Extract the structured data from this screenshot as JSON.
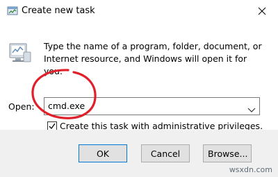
{
  "window": {
    "title": "Create new task",
    "icon": "task-manager-icon",
    "close_icon": "close-icon"
  },
  "dialog": {
    "icon": "run-dialog-icon",
    "description": "Type the name of a program, folder, document, or Internet resource, and Windows will open it for you.",
    "open_label": "Open:",
    "open_value": "cmd.exe",
    "admin_checkbox": {
      "label": "Create this task with administrative privileges.",
      "checked": true
    }
  },
  "buttons": {
    "ok": "OK",
    "cancel": "Cancel",
    "browse": "Browse..."
  },
  "annotation": {
    "circle_color": "#e0202a"
  },
  "watermark": "wsxdn.com"
}
